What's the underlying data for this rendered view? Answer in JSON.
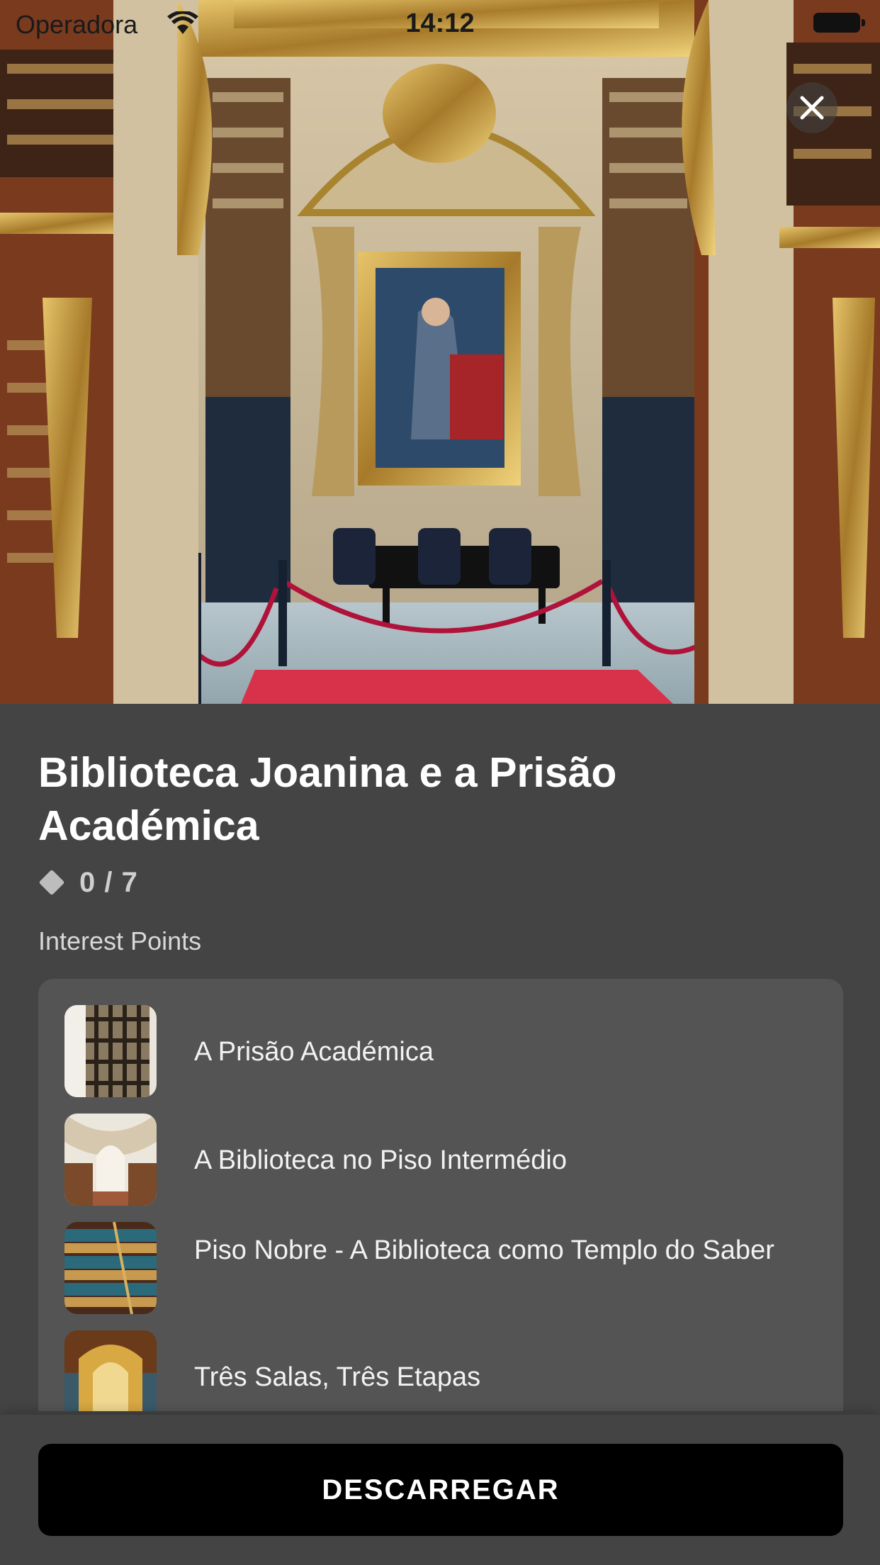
{
  "status_bar": {
    "carrier": "Operadora",
    "time": "14:12"
  },
  "hero": {
    "icon_close": "close-icon"
  },
  "tour": {
    "title": "Biblioteca Joanina e a Prisão Académica",
    "progress_count": "0 / 7",
    "progress_icon": "diamond-icon"
  },
  "interest_points": {
    "label": "Interest Points",
    "items": [
      {
        "label": "A Prisão Académica"
      },
      {
        "label": "A Biblioteca no Piso Intermédio"
      },
      {
        "label": "Piso Nobre - A Biblioteca como Templo do Saber"
      },
      {
        "label": "Três Salas, Três Etapas"
      }
    ]
  },
  "actions": {
    "download_label": "DESCARREGAR"
  },
  "colors": {
    "background": "#444444",
    "card": "#545454",
    "button": "#000000",
    "rope": "#b0123a",
    "carpet": "#d8324a"
  }
}
